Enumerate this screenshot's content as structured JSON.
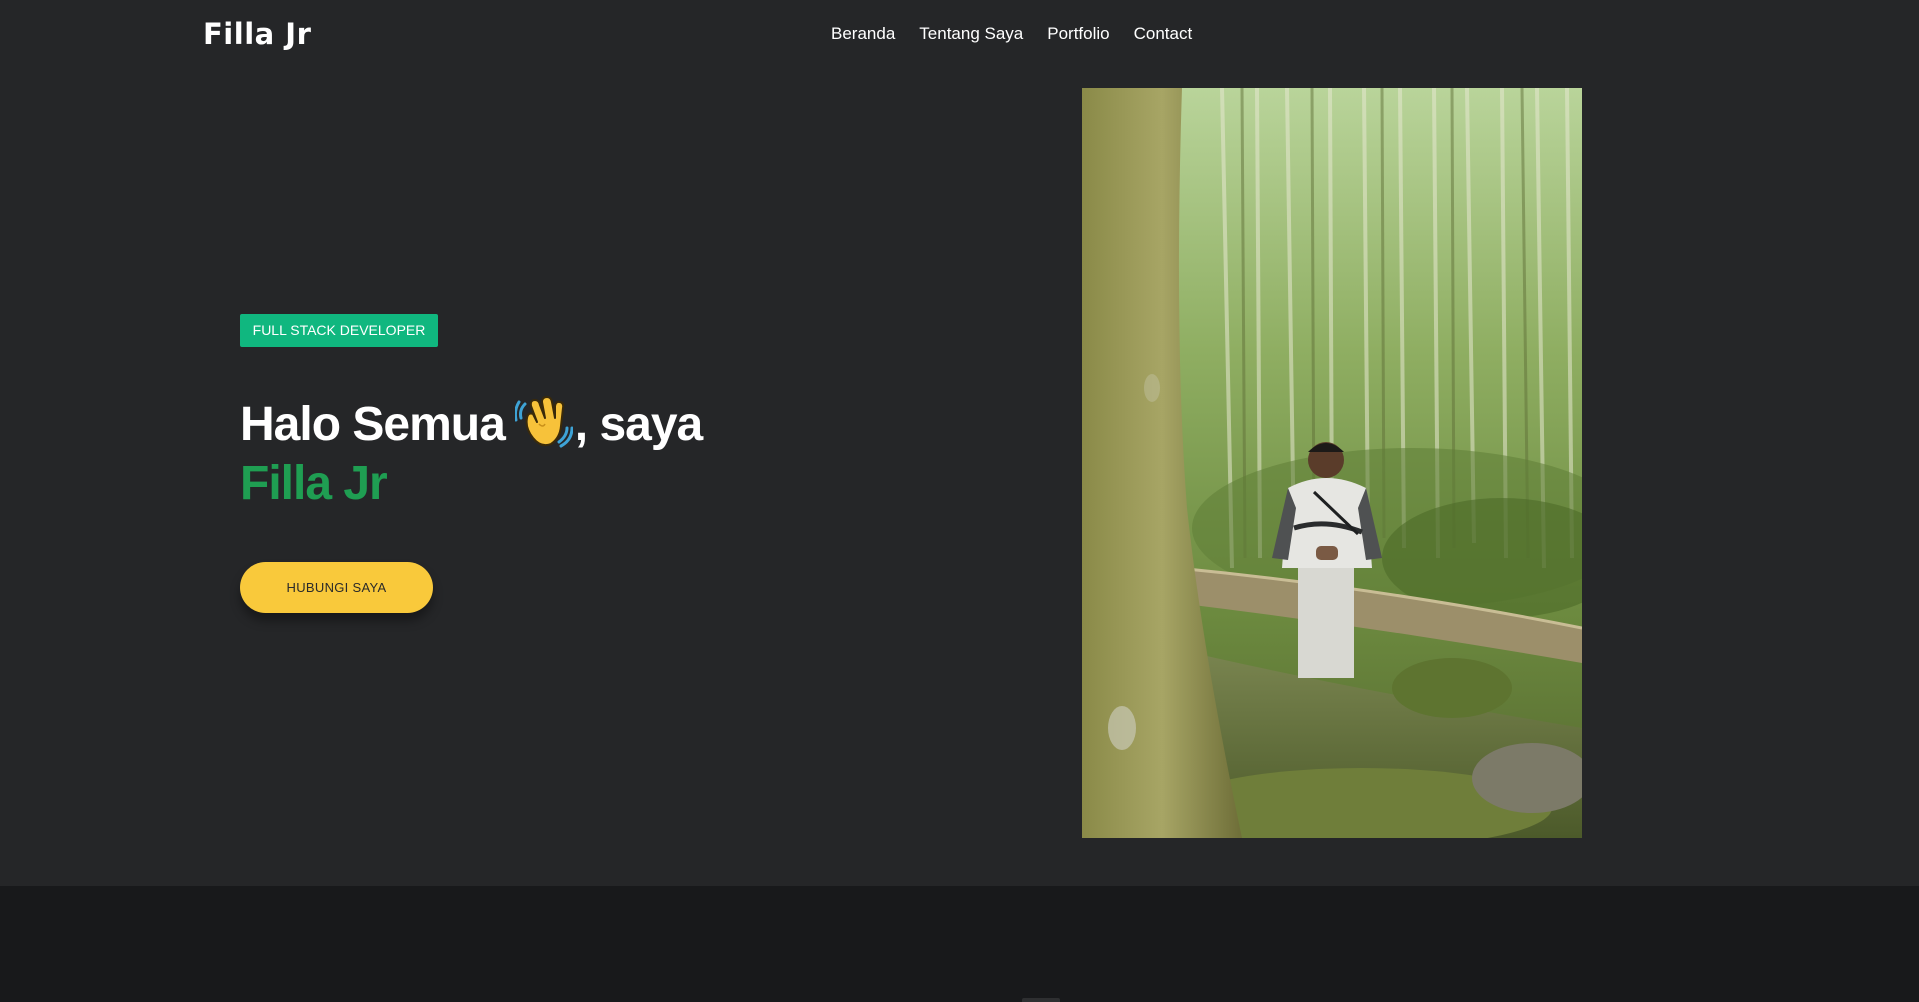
{
  "navbar": {
    "brand": "Filla Jr",
    "links": [
      {
        "label": "Beranda"
      },
      {
        "label": "Tentang Saya"
      },
      {
        "label": "Portfolio"
      },
      {
        "label": "Contact"
      }
    ]
  },
  "hero": {
    "badge": "FULL STACK DEVELOPER",
    "greeting_before": "Halo Semua",
    "greeting_after": ", saya",
    "name": "Filla Jr",
    "cta_label": "HUBUNGI SAYA"
  },
  "icons": {
    "wave": "waving-hand-icon"
  },
  "colors": {
    "background": "#252628",
    "footer_background": "#18191b",
    "badge": "#10b77f",
    "name_accent": "#1f9e52",
    "cta": "#f9c93b"
  }
}
